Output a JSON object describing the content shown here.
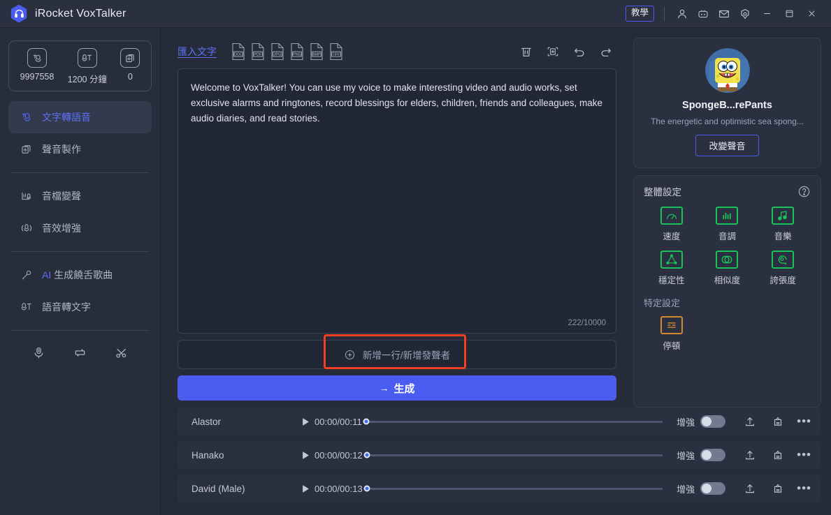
{
  "titlebar": {
    "app_title": "iRocket VoxTalker",
    "logo_icon": "headphone-hexagon-logo",
    "tutorial_label": "教學",
    "icons": [
      "user-icon",
      "discord-icon",
      "mail-icon",
      "settings-icon"
    ],
    "window_controls": [
      "minimize-icon",
      "maximize-icon",
      "close-icon"
    ]
  },
  "sidebar": {
    "credits": [
      {
        "icon": "tts-credit-icon",
        "value": "9997558"
      },
      {
        "icon": "stt-minutes-icon",
        "value": "1200 分鐘"
      },
      {
        "icon": "voice-clone-icon",
        "value": "0"
      }
    ],
    "items": [
      {
        "label": "文字轉語音",
        "icon": "text-to-speech-icon",
        "active": true
      },
      {
        "label": "聲音製作",
        "icon": "voice-production-icon",
        "active": false
      },
      {
        "label": "音檔變聲",
        "icon": "audio-voice-change-icon",
        "active": false
      },
      {
        "label": "音效增強",
        "icon": "audio-enhance-icon",
        "active": false
      },
      {
        "label": "AI 生成饒舌歌曲",
        "label_prefix": "AI",
        "label_rest": " 生成饒舌歌曲",
        "icon": "ai-rap-song-icon",
        "active": false
      },
      {
        "label": "語音轉文字",
        "icon": "speech-to-text-icon",
        "active": false
      }
    ],
    "tools": [
      "recorder-icon",
      "converter-icon",
      "cutter-icon"
    ]
  },
  "editor": {
    "import_label": "匯入文字",
    "filetypes": [
      "DOC",
      "PDF",
      "JPG",
      "PNG",
      "BMP",
      "TIFF"
    ],
    "actions": [
      "delete-icon",
      "add-segment-icon",
      "undo-icon",
      "redo-icon"
    ],
    "text_value": "Welcome to VoxTalker! You can use my voice to make interesting video and audio works, set exclusive alarms and ringtones, record blessings for elders, children, friends and colleagues, make audio diaries, and read stories.",
    "char_count": "222/10000",
    "add_row_label": "新增一行/新增發聲者",
    "generate_arrow": "→",
    "generate_label": "生成",
    "highlight_color": "#f5401f"
  },
  "voice_card": {
    "avatar_icon": "spongebob-avatar",
    "name": "SpongeB...rePants",
    "description": "The energetic and optimistic sea spong...",
    "change_button": "改變聲音"
  },
  "settings": {
    "title": "整體設定",
    "help_icon": "help-circle-icon",
    "global": [
      {
        "label": "速度",
        "icon": "speed-gauge-icon",
        "color": "#19c25a"
      },
      {
        "label": "音調",
        "icon": "pitch-bars-icon",
        "color": "#19c25a"
      },
      {
        "label": "音樂",
        "icon": "music-note-icon",
        "color": "#19c25a"
      },
      {
        "label": "穩定性",
        "icon": "stability-triangle-icon",
        "color": "#19c25a"
      },
      {
        "label": "相似度",
        "icon": "similarity-circles-icon",
        "color": "#19c25a"
      },
      {
        "label": "誇張度",
        "icon": "exaggeration-face-icon",
        "color": "#19c25a"
      }
    ],
    "specific_title": "特定設定",
    "specific": [
      {
        "label": "停頓",
        "icon": "pause-lines-icon",
        "color": "#d08a2e"
      }
    ]
  },
  "tracks": {
    "enhance_label": "增強",
    "rows": [
      {
        "name": "Alastor",
        "time": "00:00/00:11",
        "enhance_on": false
      },
      {
        "name": "Hanako",
        "time": "00:00/00:12",
        "enhance_on": false
      },
      {
        "name": "David (Male)",
        "time": "00:00/00:13",
        "enhance_on": false
      }
    ],
    "row_icons": [
      "export-icon",
      "save-preset-icon",
      "more-options-icon"
    ],
    "more_glyph": "•••"
  }
}
